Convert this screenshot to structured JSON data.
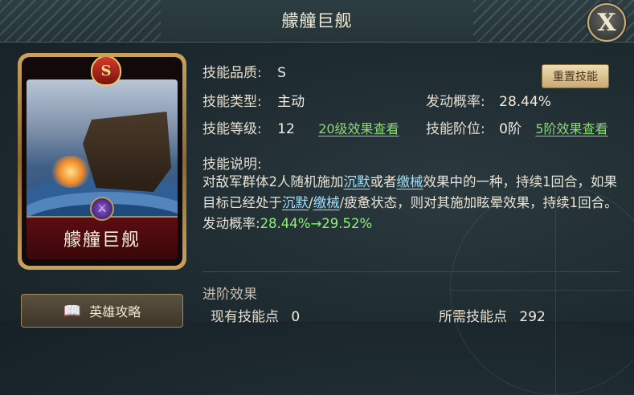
{
  "title": "艨艟巨舰",
  "close_label": "X",
  "card": {
    "grade": "S",
    "name": "艨艟巨舰",
    "type_icon": "crossed-swords-icon"
  },
  "guide_button": {
    "label": "英雄攻略",
    "icon": "book-icon"
  },
  "skill": {
    "quality_label": "技能品质:",
    "quality_value": "S",
    "type_label": "技能类型:",
    "type_value": "主动",
    "level_label": "技能等级:",
    "level_value": "12",
    "level_link": "20级效果查看",
    "trigger_label": "发动概率:",
    "trigger_value": "28.44%",
    "tier_label": "技能阶位:",
    "tier_value": "0阶",
    "tier_link": "5阶效果查看",
    "reset_button": "重置技能"
  },
  "description": {
    "header": "技能说明:",
    "p1": "对敌军群体2人随机施加",
    "kw1": "沉默",
    "p2": "或者",
    "kw2": "缴械",
    "p3": "效果中的一种，持续1回合，如果目标已经处于",
    "kw3": "沉默",
    "slash1": "/",
    "kw4": "缴械",
    "p4": "/疲惫状态，则对其施加眩晕效果，持续1回合。发动概率:",
    "rate": "28.44%→29.52%"
  },
  "advance": {
    "header": "进阶效果",
    "owned_label": "现有技能点",
    "owned_value": "0",
    "required_label": "所需技能点",
    "required_value": "292"
  }
}
